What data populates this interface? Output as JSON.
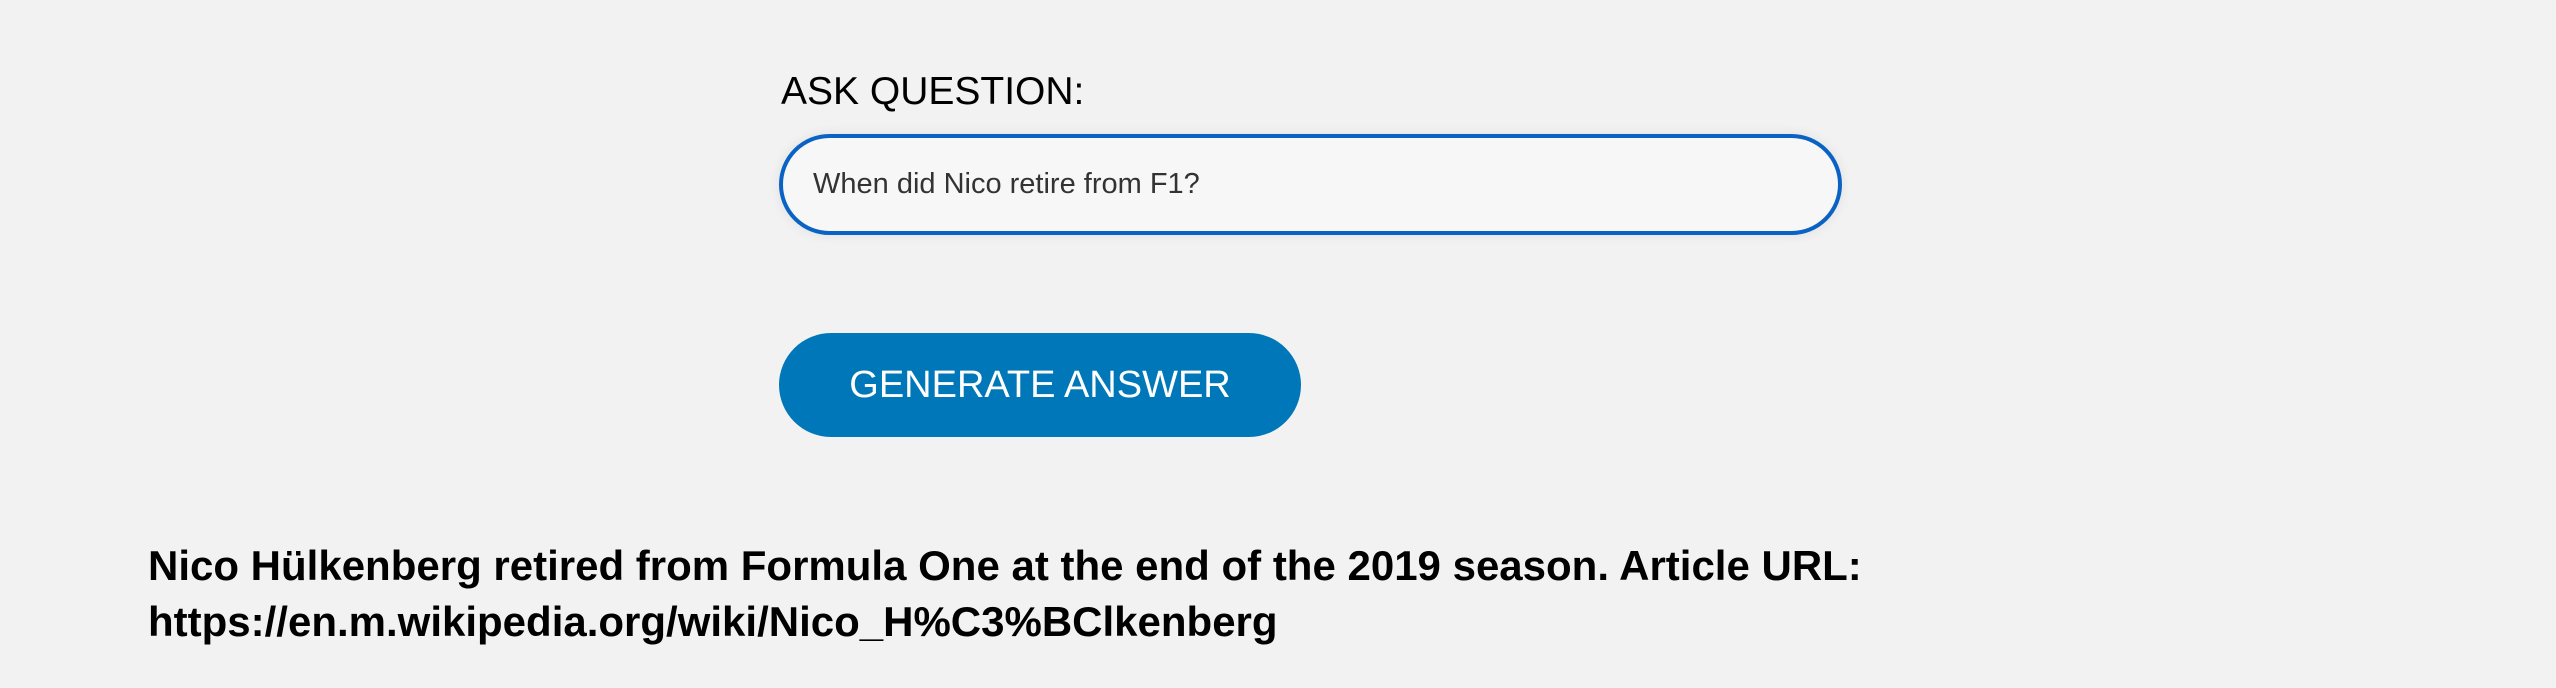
{
  "form": {
    "label": "ASK QUESTION:",
    "question_value": "When did Nico retire from F1?",
    "generate_label": "GENERATE ANSWER"
  },
  "answer": {
    "text": "Nico Hülkenberg retired from Formula One at the end of the 2019 season. Article URL: https://en.m.wikipedia.org/wiki/Nico_H%C3%BClkenberg"
  },
  "colors": {
    "background": "#f2f2f2",
    "input_border": "#0a63c4",
    "button": "#0077b8"
  }
}
